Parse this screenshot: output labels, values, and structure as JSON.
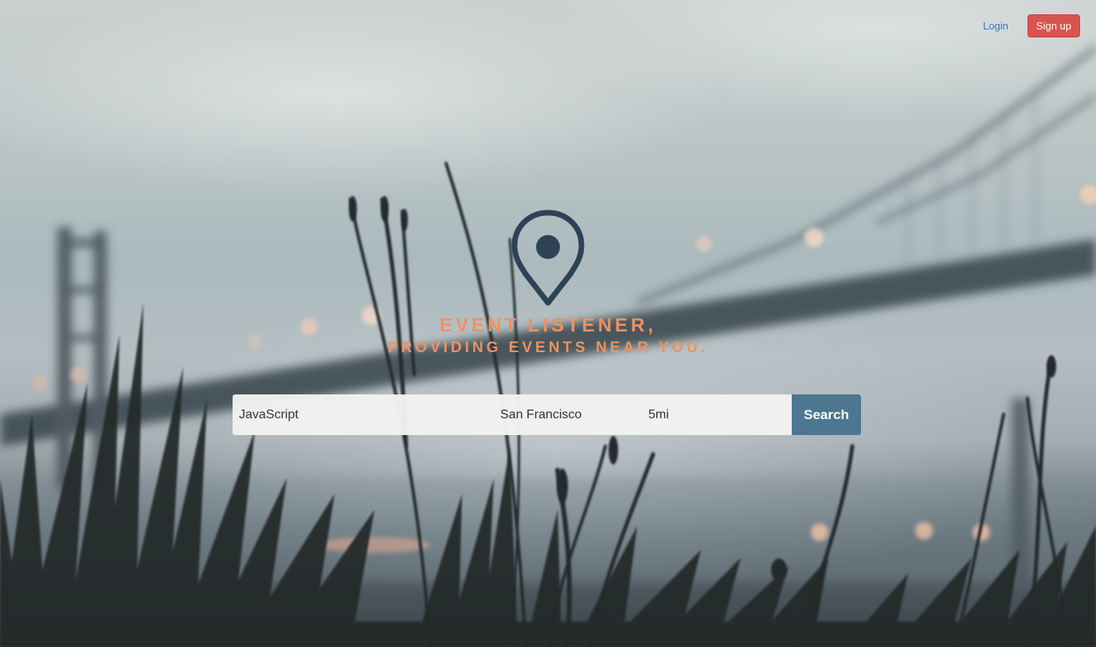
{
  "header": {
    "login_label": "Login",
    "signup_label": "Sign up"
  },
  "hero": {
    "title": "EVENT LISTENER,",
    "subtitle": "PROVIDING EVENTS NEAR YOU."
  },
  "search": {
    "keyword_value": "JavaScript",
    "location_value": "San Francisco",
    "radius_value": "5mi",
    "button_label": "Search"
  },
  "icons": {
    "hero_icon": "map-pin-icon"
  },
  "colors": {
    "accent_text": "#f0915e",
    "signup_bg": "#d9534f",
    "login_link": "#337ab7",
    "search_button_bg": "#4d7690",
    "pin_color": "#2e4256"
  }
}
